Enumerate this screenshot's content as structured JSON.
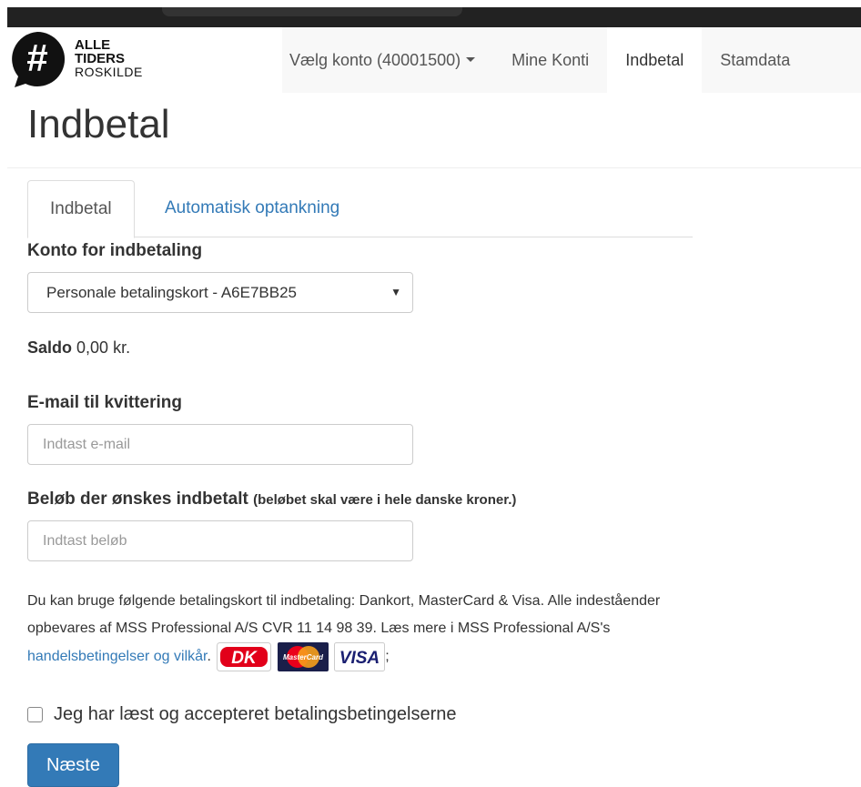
{
  "brand": {
    "line1": "ALLE",
    "line2": "TIDERS",
    "line3": "ROSKILDE",
    "mark": "#"
  },
  "nav": {
    "account_select": "Vælg konto (40001500)",
    "items": [
      "Mine Konti",
      "Indbetal",
      "Stamdata"
    ]
  },
  "page": {
    "title": "Indbetal"
  },
  "tabs": [
    "Indbetal",
    "Automatisk optankning"
  ],
  "form": {
    "account_label": "Konto for indbetaling",
    "account_value": "Personale betalingskort - A6E7BB25",
    "saldo_label": "Saldo",
    "saldo_value": "0,00 kr.",
    "email_label": "E-mail til kvittering",
    "email_placeholder": "Indtast e-mail",
    "amount_label": "Beløb der ønskes indbetalt",
    "amount_note": "(beløbet skal være i hele danske kroner.)",
    "amount_placeholder": "Indtast beløb",
    "info_text": "Du kan bruge følgende betalingskort til indbetaling: Dankort, MasterCard & Visa. Alle indeståender opbevares af MSS Professional A/S CVR 11 14 98 39. Læs mere i MSS Professional A/S's",
    "info_link": "handelsbetingelser og vilkår",
    "info_after_link": ".",
    "info_end": ";",
    "card_dk": "DK",
    "card_mastercard": "MasterCard",
    "card_visa": "VISA",
    "terms_label": "Jeg har læst og accepteret betalingsbetingelserne",
    "next_button": "Næste"
  },
  "colors": {
    "primary": "#337ab7",
    "dankort_red": "#e2001a",
    "mastercard_red": "#eb001b",
    "mastercard_orange": "#f79e1b",
    "visa_blue": "#1a1f71"
  }
}
